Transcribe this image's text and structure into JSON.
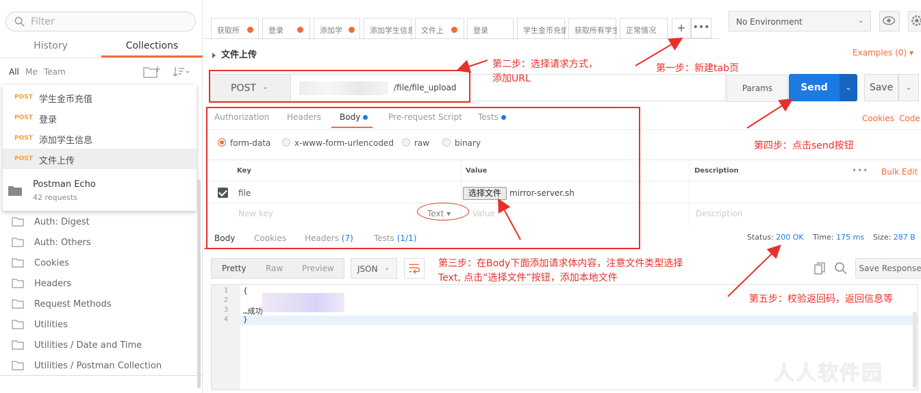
{
  "sidebar": {
    "filter_placeholder": "Filter",
    "tabs": [
      "History",
      "Collections"
    ],
    "scopes": [
      "All",
      "Me",
      "Team"
    ],
    "requests": [
      {
        "method": "POST",
        "name": "学生金币充值"
      },
      {
        "method": "POST",
        "name": "登录"
      },
      {
        "method": "POST",
        "name": "添加学生信息"
      },
      {
        "method": "POST",
        "name": "文件上传"
      }
    ],
    "echo": {
      "name": "Postman Echo",
      "count": "42 requests"
    },
    "folders": [
      "Auth: Digest",
      "Auth: Others",
      "Cookies",
      "Headers",
      "Request Methods",
      "Utilities",
      "Utilities / Date and Time",
      "Utilities / Postman Collection"
    ]
  },
  "tabs": [
    "获取所",
    "登录",
    "添加学",
    "添加学生信息",
    "文件上",
    "登录",
    "学生金币充值",
    "获取所有学生",
    "正常情况"
  ],
  "environment": "No Environment",
  "request": {
    "title": "文件上传",
    "examples": "Examples (0)",
    "method": "POST",
    "url": "/file/file_upload",
    "params": "Params",
    "send": "Send",
    "save": "Save"
  },
  "req_tabs": [
    "Authorization",
    "Headers",
    "Body",
    "Pre-request Script",
    "Tests"
  ],
  "cookies": "Cookies",
  "code": "Code",
  "body_modes": [
    "form-data",
    "x-www-form-urlencoded",
    "raw",
    "binary"
  ],
  "kv": {
    "headers": [
      "Key",
      "Value",
      "Description"
    ],
    "bulk_edit": "Bulk Edit",
    "row_key": "file",
    "choose_file": "选择文件",
    "file_name": "mirror-server.sh",
    "new_key": "New key",
    "type": "Text",
    "new_value": "Value",
    "new_desc": "Description"
  },
  "res_tabs": [
    {
      "label": "Body",
      "count": ""
    },
    {
      "label": "Cookies",
      "count": ""
    },
    {
      "label": "Headers",
      "count": "(7)"
    },
    {
      "label": "Tests",
      "count": "(1/1)"
    }
  ],
  "status": {
    "status_label": "Status:",
    "status": "200 OK",
    "time_label": "Time:",
    "time": "175 ms",
    "size_label": "Size:",
    "size": "287 B"
  },
  "views": [
    "Pretty",
    "Raw",
    "Preview"
  ],
  "format": "JSON",
  "save_response": "Save Response",
  "code_lines": [
    {
      "n": "1",
      "t": "{"
    },
    {
      "n": "2",
      "t": ""
    },
    {
      "n": "3",
      "t": "          …成功\""
    },
    {
      "n": "4",
      "t": "}"
    }
  ],
  "annotations": {
    "step1": "第一步：新建tab页",
    "step2_l1": "第二步：选择请求方式，",
    "step2_l2": "添加URL",
    "step3_l1": "第三步：在Body下面添加请求体内容，注意文件类型选择",
    "step3_l2": "Text, 点击“选择文件”按钮，添加本地文件",
    "step4": "第四步：点击send按钮",
    "step5": "第五步：校验返回码，返回信息等"
  },
  "watermark": "人人软件园",
  "colors": {
    "accent": "#f26b3a",
    "send_blue": "#1c7ae0",
    "annotation_red": "#e8302a",
    "post_orange": "#f3a23b"
  }
}
